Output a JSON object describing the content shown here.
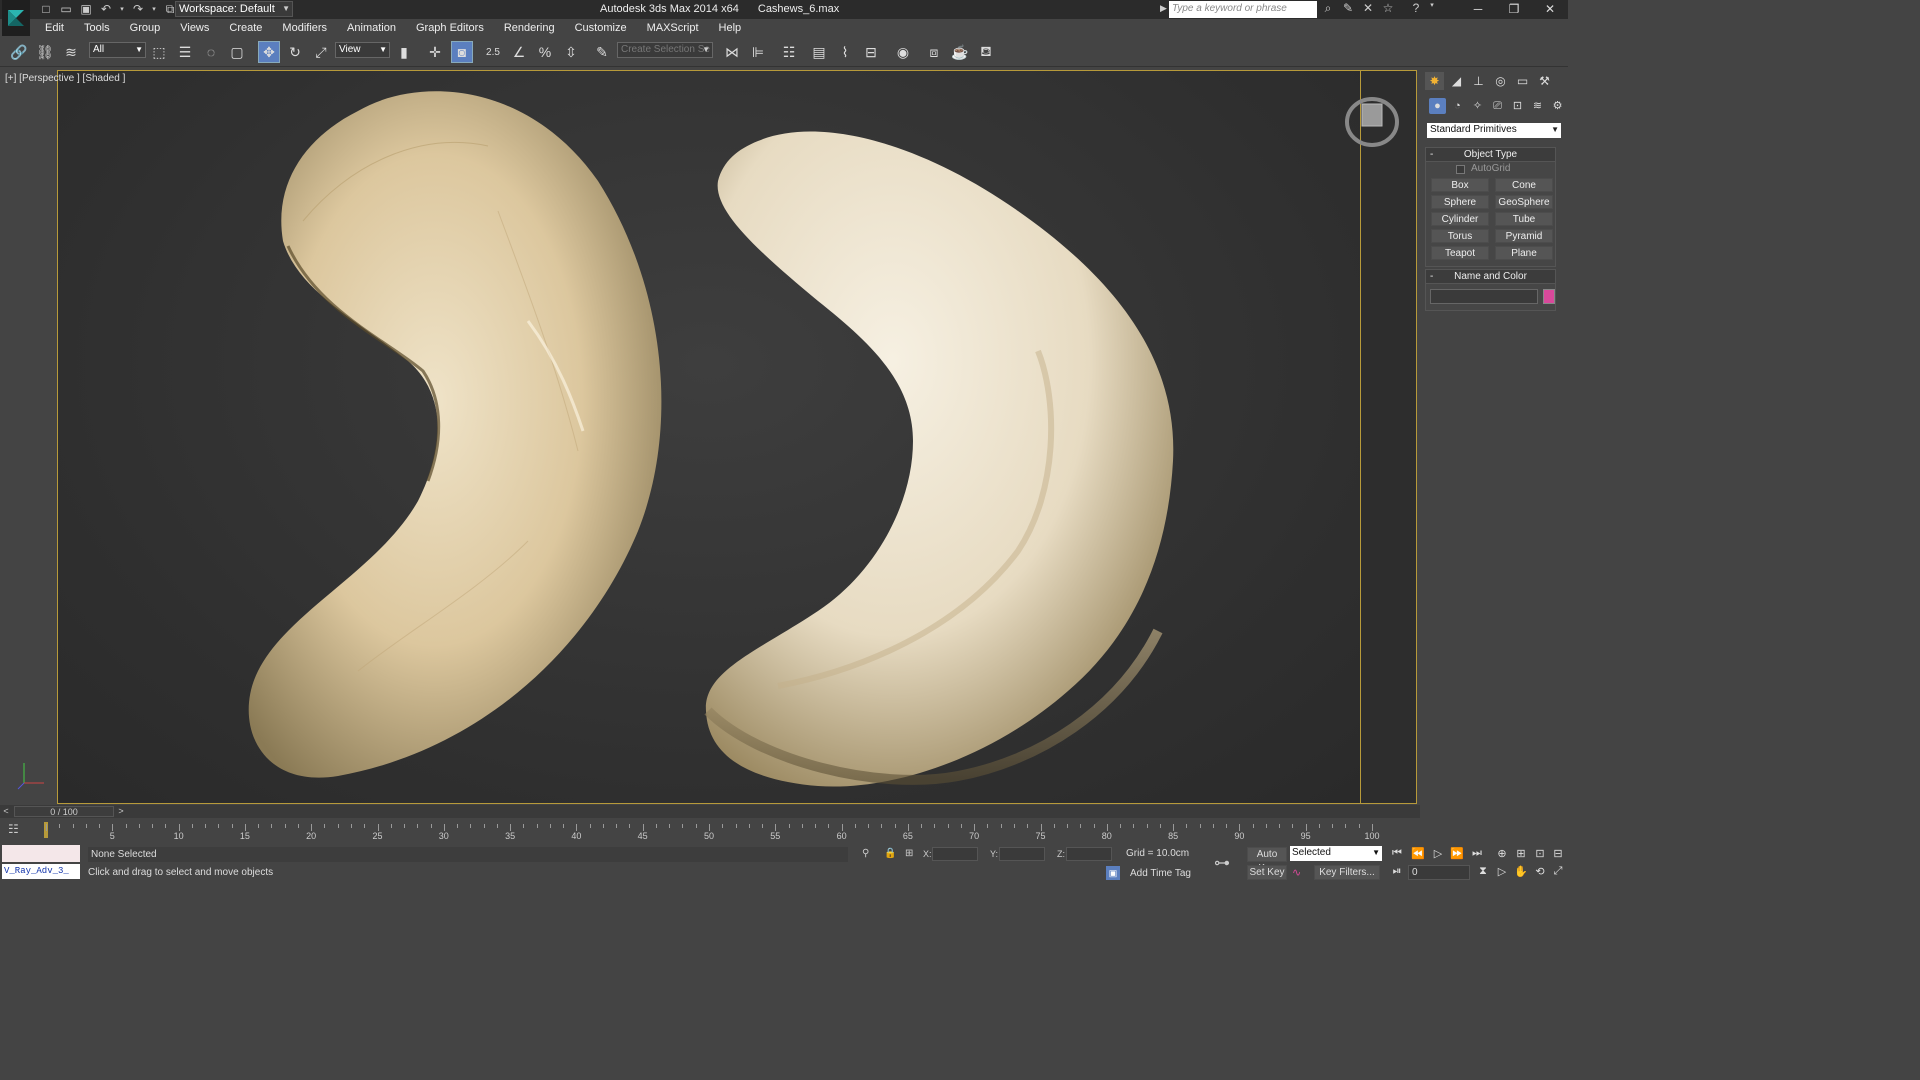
{
  "titlebar": {
    "workspace": "Workspace: Default",
    "app_title": "Autodesk 3ds Max  2014 x64",
    "file_name": "Cashews_6.max",
    "search_placeholder": "Type a keyword or phrase"
  },
  "menu": [
    "Edit",
    "Tools",
    "Group",
    "Views",
    "Create",
    "Modifiers",
    "Animation",
    "Graph Editors",
    "Rendering",
    "Customize",
    "MAXScript",
    "Help"
  ],
  "toolbar": {
    "filter_select": "All",
    "coord_select": "View",
    "snap_label": "2.5",
    "selection_set_placeholder": "Create Selection Se"
  },
  "viewport": {
    "label": "[+] [Perspective ] [Shaded ]"
  },
  "command_panel": {
    "category": "Standard Primitives",
    "object_type_title": "Object Type",
    "autogrid_label": "AutoGrid",
    "buttons": [
      "Box",
      "Cone",
      "Sphere",
      "GeoSphere",
      "Cylinder",
      "Tube",
      "Torus",
      "Pyramid",
      "Teapot",
      "Plane"
    ],
    "name_color_title": "Name and Color",
    "color": "#d9499b"
  },
  "timeline": {
    "frame_display": "0 / 100",
    "ticks": [
      "5",
      "10",
      "15",
      "20",
      "25",
      "30",
      "35",
      "40",
      "45",
      "50",
      "55",
      "60",
      "65",
      "70",
      "75",
      "80",
      "85",
      "90",
      "95",
      "100"
    ]
  },
  "status": {
    "maxscript_text": "V_Ray_Adv_3_",
    "selection": "None Selected",
    "prompt": "Click and drag to select and move objects",
    "x_label": "X:",
    "y_label": "Y:",
    "z_label": "Z:",
    "grid": "Grid = 10.0cm",
    "add_time_tag": "Add Time Tag",
    "auto_key": "Auto Key",
    "set_key": "Set Key",
    "selected_select": "Selected",
    "key_filters": "Key Filters...",
    "frame_value": "0"
  },
  "colors": {
    "viewport_border": "#b79a3a",
    "accent": "#5b7fbf"
  }
}
